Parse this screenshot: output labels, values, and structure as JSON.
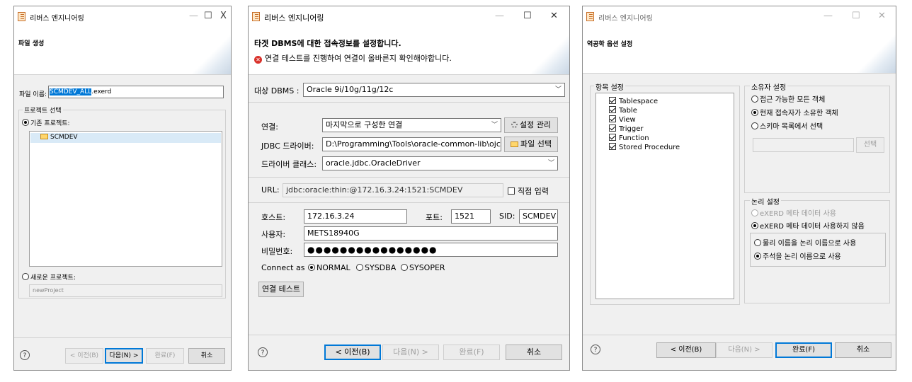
{
  "window1": {
    "title": "리버스 엔지니어링",
    "controls": {
      "minimize": "—",
      "maximize": "☐",
      "close": "X"
    },
    "header_title": "파일 생성",
    "filename_label": "파일 이름:",
    "filename_value_selected": "SCMDEV_ALL",
    "filename_value_ext": ".exerd",
    "project_group_label": "프로젝트 선택",
    "existing_project_label": "기존 프로젝트:",
    "project_item": "SCMDEV",
    "new_project_label": "새로운 프로젝트:",
    "new_project_placeholder": "newProject",
    "buttons": {
      "help": "?",
      "back": "< 이전(B)",
      "next": "다음(N) >",
      "finish": "완료(F)",
      "cancel": "취소"
    }
  },
  "window2": {
    "title": "리버스 엔지니어링",
    "controls": {
      "minimize": "—",
      "maximize": "☐",
      "close": "✕"
    },
    "header_title": "타겟 DBMS에 대한 접속정보를 설정합니다.",
    "header_error": "연결 테스트를 진행하여 연결이 올바른지 확인해야합니다.",
    "target_dbms_label": "대상 DBMS :",
    "target_dbms_value": "Oracle 9i/10g/11g/12c",
    "connection_label": "연결:",
    "connection_value": "마지막으로 구성한 연결",
    "settings_button": "설정 관리",
    "jdbc_driver_label": "JDBC 드라이버:",
    "jdbc_driver_value": "D:\\Programming\\Tools\\oracle-common-lib\\ojc",
    "file_select_button": "파일 선택",
    "driver_class_label": "드라이버 클래스:",
    "driver_class_value": "oracle.jdbc.OracleDriver",
    "url_label": "URL:",
    "url_value": "jdbc:oracle:thin:@172.16.3.24:1521:SCMDEV",
    "direct_input_label": "직접 입력",
    "host_label": "호스트:",
    "host_value": "172.16.3.24",
    "port_label": "포트:",
    "port_value": "1521",
    "sid_label": "SID:",
    "sid_value": "SCMDEV",
    "user_label": "사용자:",
    "user_value": "METS18940G",
    "password_label": "비밀번호:",
    "password_value": "●●●●●●●●●●●●●●●●",
    "connect_as_label": "Connect as",
    "connect_as_options": [
      "NORMAL",
      "SYSDBA",
      "SYSOPER"
    ],
    "test_button": "연결 테스트",
    "buttons": {
      "help": "?",
      "back": "< 이전(B)",
      "next": "다음(N) >",
      "finish": "완료(F)",
      "cancel": "취소"
    }
  },
  "window3": {
    "title": "리버스 엔지니어링",
    "controls": {
      "minimize": "—",
      "maximize": "☐",
      "close": "✕"
    },
    "header_title": "역공학 옵션 설정",
    "items_group_label": "항목 설정",
    "items": [
      "Tablespace",
      "Table",
      "View",
      "Trigger",
      "Function",
      "Stored Procedure"
    ],
    "owner_group_label": "소유자 설정",
    "owner_options": [
      "접근 가능한 모든 객체",
      "현재 접속자가 소유한 객체",
      "스키마 목록에서 선택"
    ],
    "select_button": "선택",
    "logical_group_label": "논리 설정",
    "logical_options": [
      "eXERD 메타 데이터 사용",
      "eXERD 메타 데이터 사용하지 않음"
    ],
    "name_options": [
      "물리 이름을 논리 이름으로 사용",
      "주석을 논리 이름으로 사용"
    ],
    "buttons": {
      "help": "?",
      "back": "< 이전(B)",
      "next": "다음(N) >",
      "finish": "완료(F)",
      "cancel": "취소"
    }
  }
}
